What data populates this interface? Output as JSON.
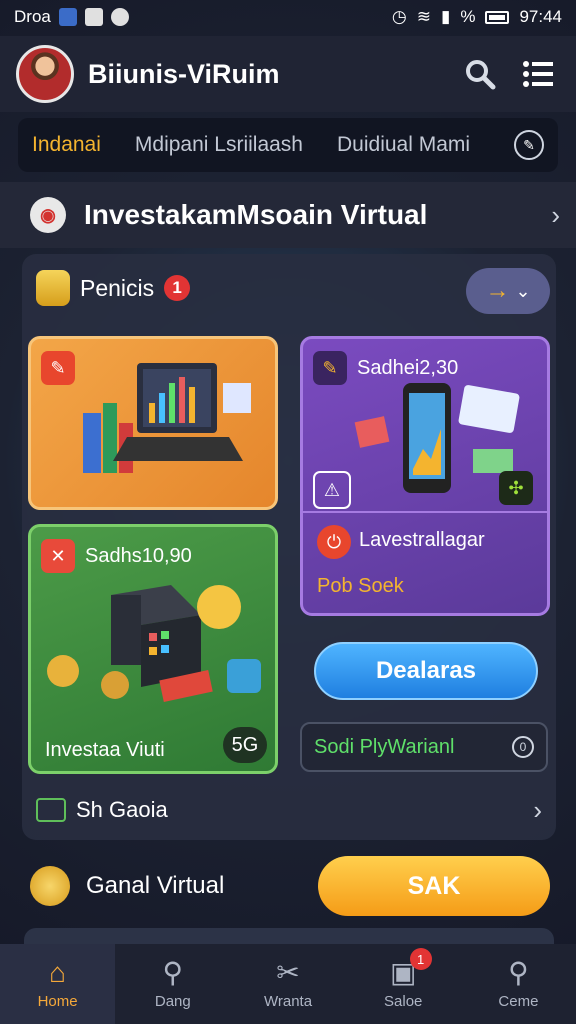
{
  "status_bar": {
    "left_text": "Droa",
    "percent": "%",
    "time": "97:44"
  },
  "app_bar": {
    "title": "Biiunis-ViRuim",
    "search_icon": "search-icon",
    "menu_icon": "menu-icon"
  },
  "tabs": [
    {
      "label": "Indanai",
      "active": true
    },
    {
      "label": "Mdipani Lsriilaash",
      "active": false
    },
    {
      "label": "Duidiual Mami",
      "active": false
    }
  ],
  "section": {
    "title": "InvestakamMsoain Virtual"
  },
  "panel": {
    "title": "Penicis",
    "badge": "1",
    "cards": {
      "orange": {
        "label": ""
      },
      "purple": {
        "label": "Sadhei2,30",
        "sub_title": "Lavestrallagar",
        "sub_label": "Pob Soek"
      },
      "green": {
        "label": "Sadhs10,90",
        "caption": "Investaa Viuti",
        "tag": "5G"
      }
    },
    "deal_button": "Dealaras",
    "green_field": "Sodi PlyWarianl",
    "footer": "Sh Gaoia"
  },
  "bottom_row": {
    "title": "Ganal Virtual",
    "button": "SAK"
  },
  "nav": [
    {
      "label": "Home",
      "icon": "home-icon",
      "active": true,
      "badge": ""
    },
    {
      "label": "Dang",
      "icon": "search-icon",
      "active": false,
      "badge": ""
    },
    {
      "label": "Wranta",
      "icon": "tools-icon",
      "active": false,
      "badge": ""
    },
    {
      "label": "Saloe",
      "icon": "bag-icon",
      "active": false,
      "badge": "1"
    },
    {
      "label": "Ceme",
      "icon": "search-icon",
      "active": false,
      "badge": ""
    }
  ],
  "colors": {
    "accent": "#f4b42f",
    "nav_active": "#f4a83a",
    "badge_red": "#e23434",
    "button_blue": "#1f7fe0"
  }
}
